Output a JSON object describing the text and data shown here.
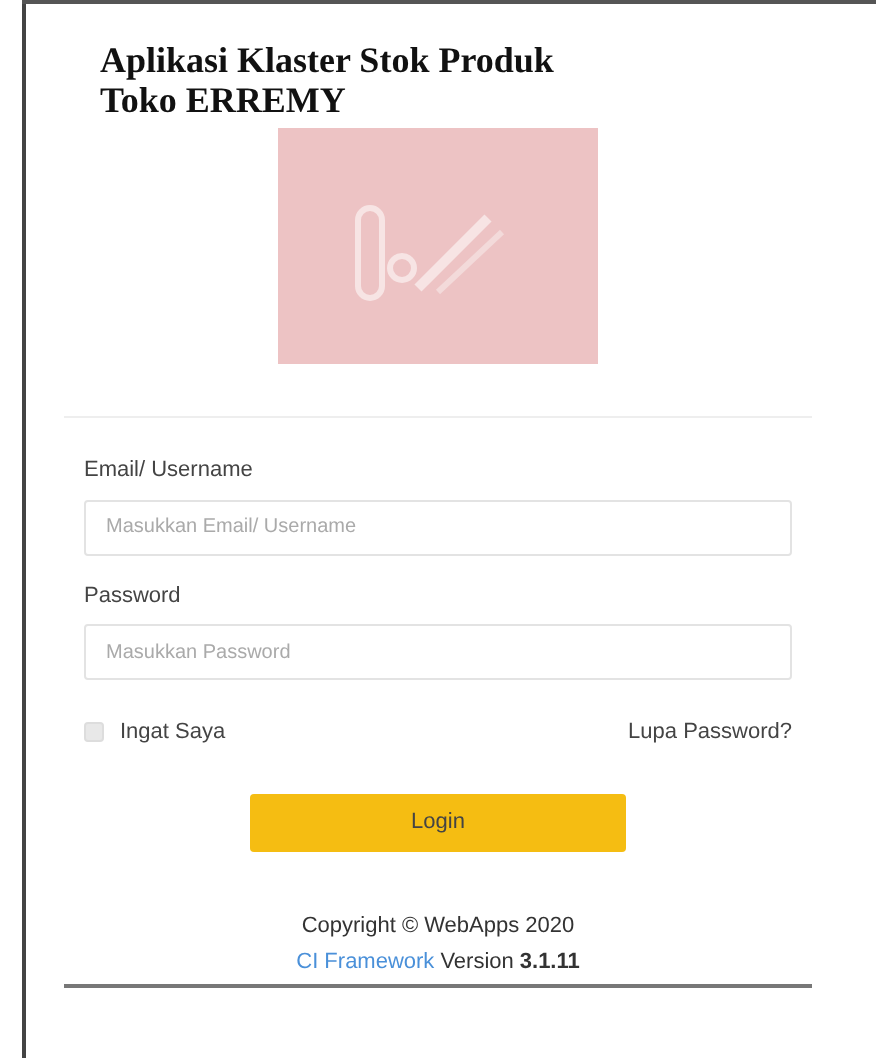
{
  "title_lines": [
    "Aplikasi Klaster Stok Produk",
    "Toko ERREMY"
  ],
  "fields": [
    {
      "label": "Email/ Username",
      "placeholder": "Masukkan Email/ Username"
    },
    {
      "label": "Password",
      "placeholder": "Masukkan Password"
    }
  ],
  "remember": {
    "label": "Ingat Saya",
    "checked": false
  },
  "forgot_link": "Lupa Password?",
  "login_button": "Login",
  "footer": {
    "copyright": "Copyright © WebApps 2020",
    "framework_link": "CI Framework",
    "version_label": "Version",
    "version": "3.1.11"
  }
}
